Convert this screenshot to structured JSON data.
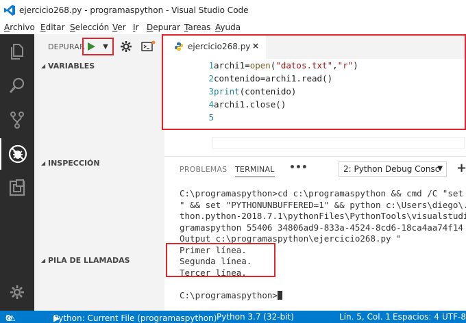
{
  "window": {
    "title": "ejercicio268.py - programaspython - Visual Studio Code"
  },
  "menu": [
    "Archivo",
    "Editar",
    "Selección",
    "Ver",
    "Ir",
    "Depurar",
    "Tareas",
    "Ayuda"
  ],
  "sidebar": {
    "debug_label": "DEPURAR",
    "sections": {
      "variables": "VARIABLES",
      "watch": "INSPECCIÓN",
      "callstack": "PILA DE LLAMADAS"
    }
  },
  "editor": {
    "tab_name": "ejercicio268.py",
    "tab_close": "×",
    "line_numbers": [
      "1",
      "2",
      "3",
      "4",
      "5"
    ]
  },
  "code_tokens": {
    "l1_a": "archi1=",
    "l1_fn": "open",
    "l1_b": "(",
    "l1_s1": "\"datos.txt\"",
    "l1_c": ",",
    "l1_s2": "\"r\"",
    "l1_d": ")",
    "l2": "contenido=archi1.read()",
    "l3_fn": "print",
    "l3_b": "(contenido)",
    "l4": "archi1.close()"
  },
  "panel": {
    "tabs": [
      "PROBLEMAS",
      "TERMINAL"
    ],
    "more": "•••",
    "terminal_select": "2: Python Debug Consc",
    "add": "+",
    "terminal_lines": [
      "C:\\programaspython>cd c:\\programaspython && cmd /C \"set \"P",
      "\" && set \"PYTHONUNBUFFERED=1\" && python c:\\Users\\diego\\.vs",
      "thon.python-2018.7.1\\pythonFiles\\PythonTools\\visualstudio_",
      "gramaspython 55406 34806ad9-833a-4524-8cd6-18ca4aa74f14 Re",
      "Output c:\\programaspython\\ejercicio268.py \"",
      "Primer línea.",
      "Segunda línea.",
      "Tercer línea.",
      "",
      "C:\\programaspython>"
    ]
  },
  "statusbar": {
    "errors": "0",
    "warnings": "0",
    "config": "Python: Current File (programaspython)",
    "interpreter": "Python 3.7 (32-bit)",
    "position": "Lín. 5, Col. 1",
    "spaces": "Espacios: 4",
    "encoding": "UTF-8"
  },
  "colors": {
    "accent": "#007acc",
    "activity_bg": "#2c2c2c",
    "highlight_box": "#e0262c",
    "run_green": "#388a34"
  }
}
